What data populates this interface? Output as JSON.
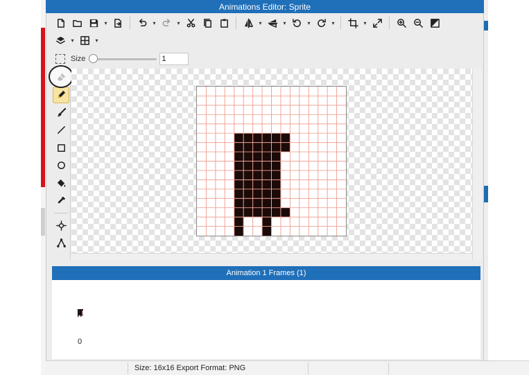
{
  "window": {
    "title": "Animations Editor: Sprite"
  },
  "toolbar": {
    "row1": [
      {
        "name": "new-icon",
        "caret": false
      },
      {
        "name": "open-folder-icon",
        "caret": false
      },
      {
        "name": "save-icon",
        "caret": true
      },
      {
        "name": "export-icon",
        "caret": false
      },
      {
        "sep": true
      },
      {
        "name": "undo-icon",
        "caret": true
      },
      {
        "name": "redo-icon",
        "caret": true
      },
      {
        "name": "cut-icon",
        "caret": false
      },
      {
        "name": "copy-icon",
        "caret": false
      },
      {
        "name": "paste-icon",
        "caret": false
      },
      {
        "sep": true
      },
      {
        "name": "flip-horizontal-icon",
        "caret": true
      },
      {
        "name": "flip-vertical-icon",
        "caret": true
      },
      {
        "name": "rotate-left-icon",
        "caret": true
      },
      {
        "name": "rotate-right-icon",
        "caret": true
      },
      {
        "sep": true
      },
      {
        "name": "crop-icon",
        "caret": true
      },
      {
        "name": "resize-icon",
        "caret": false
      },
      {
        "sep": true
      },
      {
        "name": "zoom-in-icon",
        "caret": false
      },
      {
        "name": "zoom-out-icon",
        "caret": false
      },
      {
        "name": "contrast-icon",
        "caret": false
      }
    ],
    "row2": [
      {
        "name": "layers-icon",
        "caret": true
      },
      {
        "name": "grid-icon",
        "caret": true
      }
    ]
  },
  "brush": {
    "size_label": "Size",
    "size_value": "1",
    "slider_level": 0
  },
  "tools": [
    {
      "name": "eraser-icon",
      "active": false
    },
    {
      "name": "pencil-icon",
      "active": true
    },
    {
      "name": "brush-icon",
      "active": false
    },
    {
      "name": "line-icon",
      "active": false
    },
    {
      "name": "rectangle-icon",
      "active": false
    },
    {
      "name": "ellipse-icon",
      "active": false
    },
    {
      "name": "fill-bucket-icon",
      "active": false
    },
    {
      "name": "eyedropper-icon",
      "active": false
    },
    {
      "sep": true
    },
    {
      "name": "move-point-icon",
      "active": false
    },
    {
      "name": "path-nodes-icon",
      "active": false
    }
  ],
  "sprite": {
    "grid_cols": 16,
    "grid_rows": 16,
    "grid_color": "#f1a396",
    "pixel_color": "#1a0a08",
    "pixels": [
      "................",
      "................",
      "................",
      "................",
      "................",
      "....xxxxxx......",
      "....xxxxxx......",
      "....xxxxx.......",
      "....xxxxx.......",
      "....xxxxx.......",
      "....xxxxx.......",
      "....xxxxx.......",
      "....xxxxx.......",
      "....xxxxxx......",
      "....x..x........",
      "....x..x........"
    ]
  },
  "frames": {
    "header": "Animation 1 Frames (1)",
    "items": [
      {
        "label": "0"
      }
    ]
  },
  "status": {
    "text": "Size: 16x16   Export Format: PNG"
  }
}
